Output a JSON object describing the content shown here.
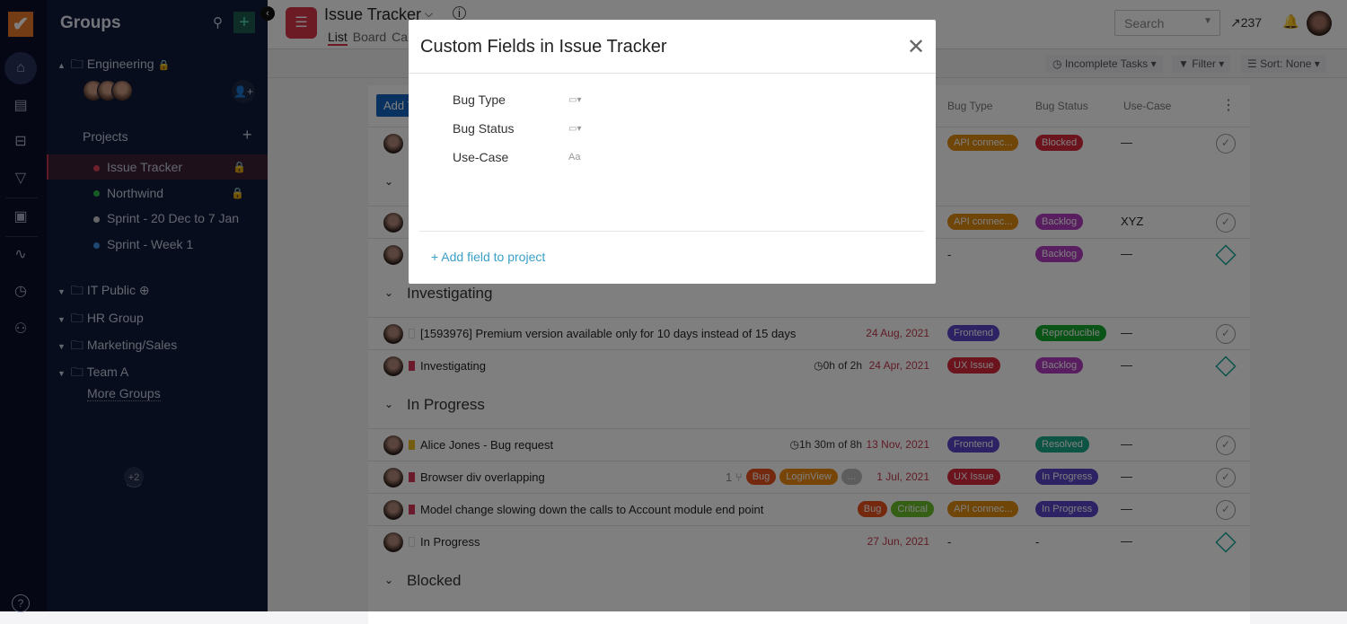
{
  "rail": {
    "icons": [
      "home-icon",
      "clipboard-icon",
      "briefcase-icon",
      "funnel-icon",
      "contacts-icon",
      "activity-icon",
      "clock-icon",
      "people-icon",
      "help-icon"
    ]
  },
  "groups": {
    "title": "Groups",
    "engineering": "Engineering",
    "avatars_more": "+2",
    "projects_label": "Projects",
    "projects": [
      {
        "name": "Issue Tracker",
        "color": "#e0405a",
        "locked": true
      },
      {
        "name": "Northwind",
        "color": "#2db84a",
        "locked": true
      },
      {
        "name": "Sprint - 20 Dec to 7 Jan",
        "color": "#cccccc",
        "locked": false
      },
      {
        "name": "Sprint - Week 1",
        "color": "#3a8fe0",
        "locked": false
      }
    ],
    "others": [
      "IT Public",
      "HR Group",
      "Marketing/Sales",
      "Team A"
    ],
    "more": "More Groups"
  },
  "header": {
    "title": "Issue Tracker",
    "tabs": [
      "List",
      "Board",
      "Ca"
    ],
    "search_placeholder": "Search",
    "stat": "237"
  },
  "toolbar": {
    "incomplete": "Incomplete Tasks",
    "filter": "Filter",
    "sort": "Sort: None"
  },
  "table": {
    "add_label": "Add T",
    "columns": [
      "Bug Type",
      "Bug Status",
      "Use-Case"
    ],
    "rows": [
      {
        "kind": "task",
        "name": "",
        "type": "API connec...",
        "type_color": "#e08a10",
        "status": "Blocked",
        "status_color": "#d8283c",
        "use": "—",
        "action": "check"
      },
      {
        "kind": "section",
        "name": ""
      },
      {
        "kind": "task",
        "name": "",
        "type": "API connec...",
        "type_color": "#e08a10",
        "status": "Backlog",
        "status_color": "#b03cc0",
        "use": "XYZ",
        "action": "check"
      },
      {
        "kind": "task",
        "name": "",
        "type": "-",
        "status": "Backlog",
        "status_color": "#b03cc0",
        "use": "—",
        "action": "diamond"
      },
      {
        "kind": "section",
        "name": "Investigating"
      },
      {
        "kind": "task",
        "name": "[1593976] Premium version available only for 10 days instead of 15 days",
        "pri": "",
        "date": "24 Aug, 2021",
        "type": "Frontend",
        "type_color": "#5a44c8",
        "status": "Reproducible",
        "status_color": "#17a82e",
        "use": "—",
        "action": "check"
      },
      {
        "kind": "task",
        "name": "Investigating",
        "pri": "#d8365a",
        "time": "0h of 2h",
        "date": "24 Apr, 2021",
        "type": "UX Issue",
        "type_color": "#d8283c",
        "status": "Backlog",
        "status_color": "#b03cc0",
        "use": "—",
        "action": "diamond"
      },
      {
        "kind": "section",
        "name": "In Progress"
      },
      {
        "kind": "task",
        "name": "Alice Jones - Bug request",
        "pri": "#e8b820",
        "time": "1h 30m of 8h",
        "date": "13 Nov, 2021",
        "type": "Frontend",
        "type_color": "#5a44c8",
        "status": "Resolved",
        "status_color": "#1ba88a",
        "use": "—",
        "action": "check"
      },
      {
        "kind": "task",
        "name": "Browser div overlapping",
        "pri": "#d8365a",
        "subtasks": "1",
        "tags": [
          {
            "t": "Bug",
            "c": "#e8501c"
          },
          {
            "t": "LoginView",
            "c": "#f08a10"
          },
          {
            "t": "...",
            "c": "#bbbbbb"
          }
        ],
        "date": "1 Jul, 2021",
        "type": "UX Issue",
        "type_color": "#d8283c",
        "status": "In Progress",
        "status_color": "#5a44c8",
        "use": "—",
        "action": "check"
      },
      {
        "kind": "task",
        "name": "Model change slowing down the calls to Account module end point",
        "pri": "#d8365a",
        "tags": [
          {
            "t": "Bug",
            "c": "#e8501c"
          },
          {
            "t": "Critical",
            "c": "#6abf2a"
          }
        ],
        "type": "API connec...",
        "type_color": "#e08a10",
        "status": "In Progress",
        "status_color": "#5a44c8",
        "use": "—",
        "action": "check"
      },
      {
        "kind": "task",
        "name": "In Progress",
        "pri": "",
        "date": "27 Jun, 2021",
        "type": "-",
        "status": "-",
        "use": "—",
        "action": "diamond"
      },
      {
        "kind": "section",
        "name": "Blocked"
      }
    ]
  },
  "modal": {
    "title": "Custom Fields in Issue Tracker",
    "fields": [
      {
        "name": "Bug Type",
        "icon": "dropdown-field-icon"
      },
      {
        "name": "Bug Status",
        "icon": "dropdown-field-icon"
      },
      {
        "name": "Use-Case",
        "icon": "text-field-icon",
        "glyph": "Aa"
      }
    ],
    "add_field": "+ Add field to project"
  }
}
